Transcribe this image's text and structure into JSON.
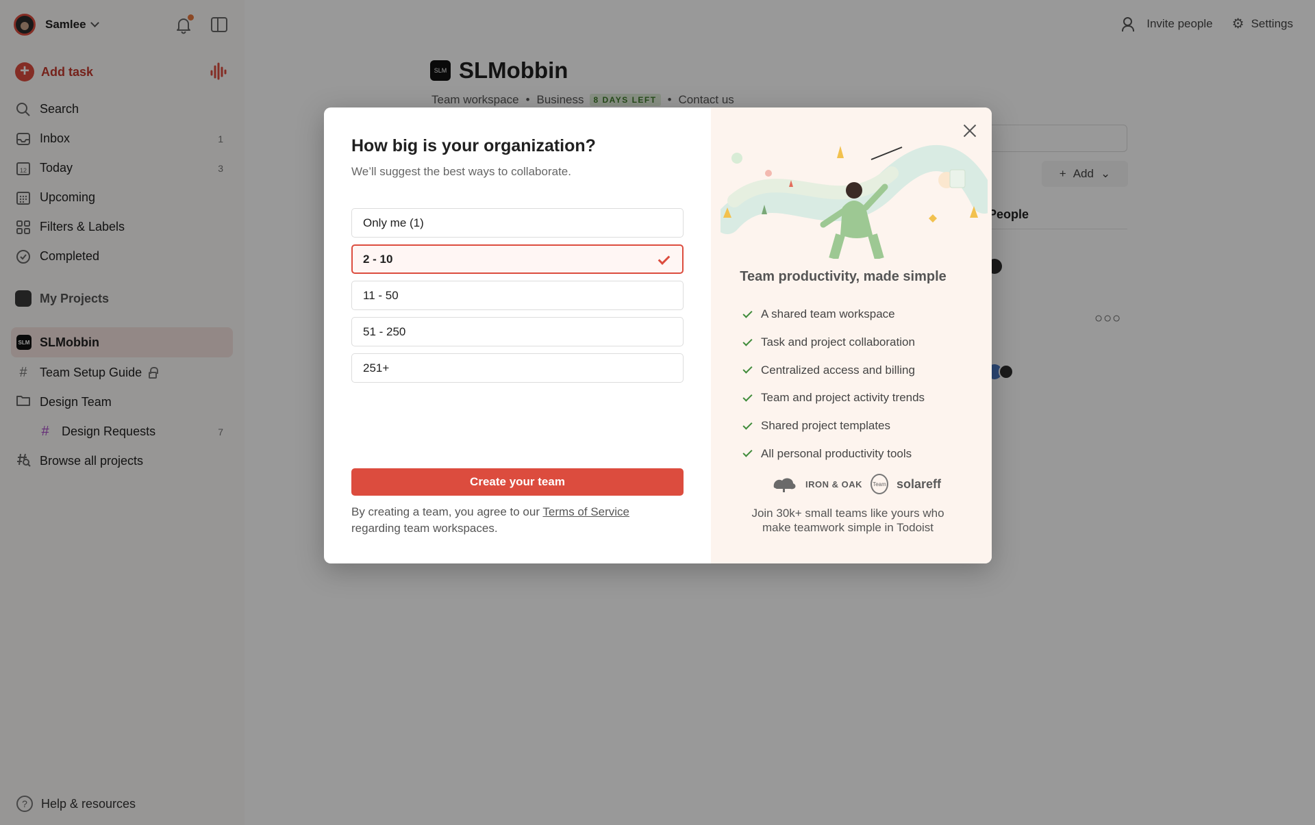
{
  "sidebar": {
    "user_name": "Samlee",
    "add_task": "Add task",
    "nav": [
      {
        "label": "Search",
        "count": ""
      },
      {
        "label": "Inbox",
        "count": "1"
      },
      {
        "label": "Today",
        "count": "3"
      },
      {
        "label": "Upcoming",
        "count": ""
      },
      {
        "label": "Filters & Labels",
        "count": ""
      },
      {
        "label": "Completed",
        "count": ""
      }
    ],
    "my_projects": "My Projects",
    "workspace": "SLMobbin",
    "projects": [
      {
        "label": "Team Setup Guide",
        "count": ""
      },
      {
        "label": "Design Team",
        "count": ""
      },
      {
        "label": "Design Requests",
        "count": "7"
      },
      {
        "label": "Browse all projects",
        "count": ""
      }
    ],
    "help": "Help & resources"
  },
  "topbar": {
    "invite": "Invite people",
    "settings": "Settings"
  },
  "project": {
    "name": "SLMobbin",
    "type": "Team workspace",
    "plan": "Business",
    "trial_badge": "8 DAYS LEFT",
    "contact": "Contact us",
    "add_button": "Add",
    "people_header": "People"
  },
  "modal": {
    "title": "How big is your organization?",
    "subtitle": "We’ll suggest the best ways to collaborate.",
    "options": [
      "Only me (1)",
      "2 - 10",
      "11 - 50",
      "51 - 250",
      "251+"
    ],
    "selected_option": "2 - 10",
    "create_button": "Create your team",
    "terms_prefix": "By creating a team, you agree to our",
    "terms_link": "Terms of Service",
    "terms_suffix": "regarding team workspaces.",
    "right_title": "Team productivity, made simple",
    "features": [
      "A shared team workspace",
      "Task and project collaboration",
      "Centralized access and billing",
      "Team and project activity trends",
      "Shared project templates",
      "All personal productivity tools"
    ],
    "logos": {
      "iron_oak": "IRON & OAK",
      "team": "Team",
      "solareff": "solareff"
    },
    "join_text": "Join 30k+ small teams like yours who make teamwork simple in Todoist"
  },
  "colors": {
    "accent": "#dc4c3e",
    "check_green": "#3f8b3a",
    "badge_bg": "#e3f0dc",
    "badge_text": "#3f7d2a"
  }
}
